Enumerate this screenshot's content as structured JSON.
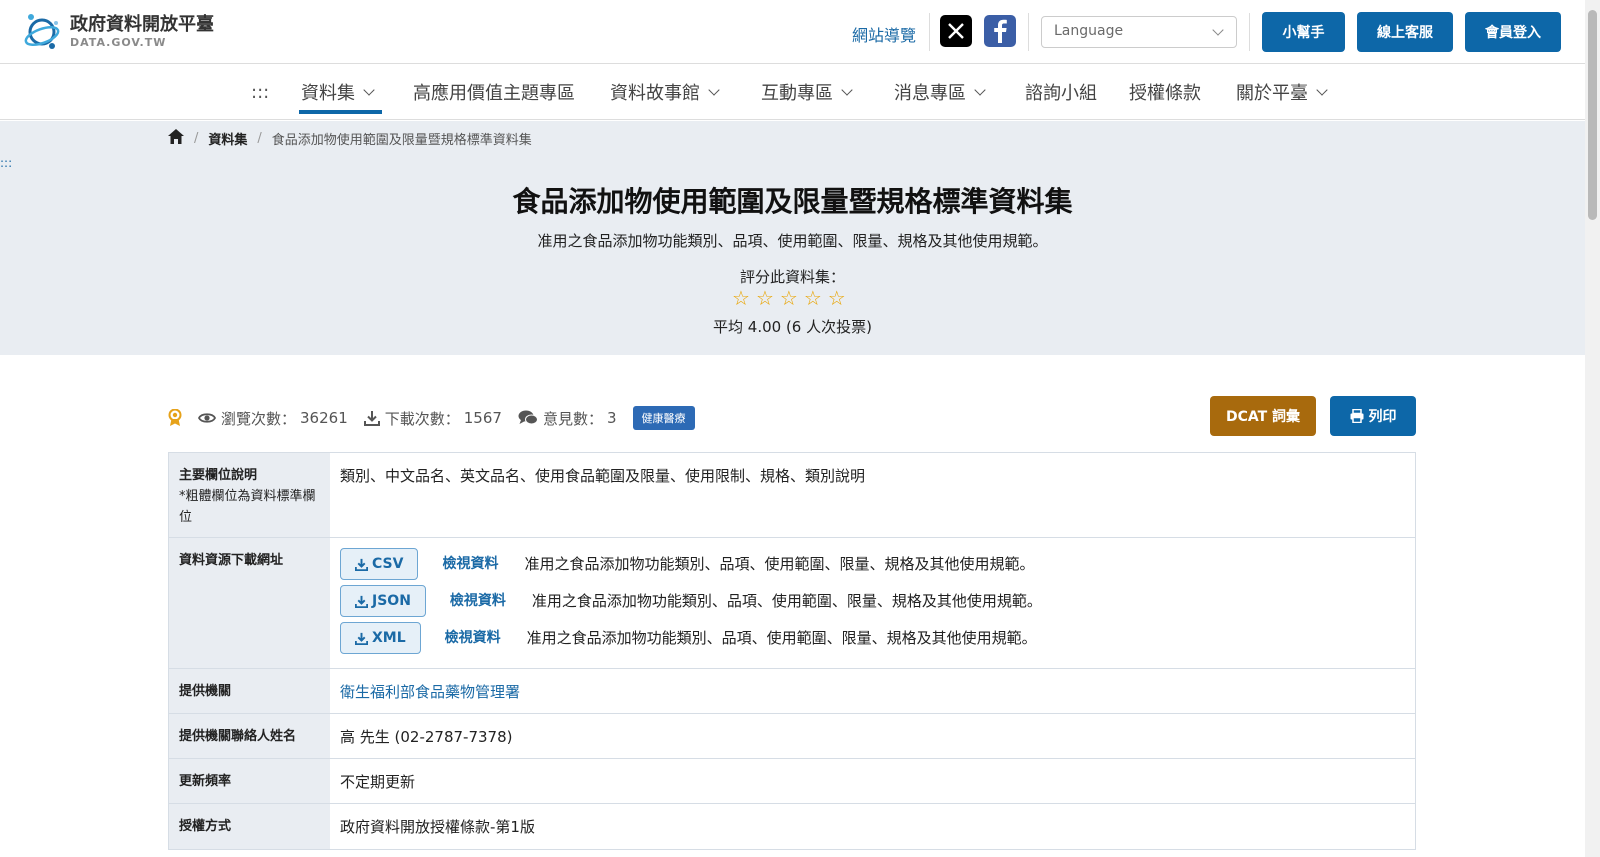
{
  "header": {
    "logo_zh": "政府資料開放平臺",
    "logo_en": "DATA.GOV.TW",
    "sitemap": "網站導覽",
    "x_icon": "x-logo-icon",
    "fb_icon": "facebook-icon",
    "language_placeholder": "Language",
    "buttons": {
      "helper": "小幫手",
      "support": "線上客服",
      "login": "會員登入"
    }
  },
  "nav": {
    "skip": ":::",
    "items": [
      {
        "label": "資料集",
        "has_menu": true,
        "active": true
      },
      {
        "label": "高應用價值主題專區",
        "has_menu": false
      },
      {
        "label": "資料故事館",
        "has_menu": true
      },
      {
        "label": "互動專區",
        "has_menu": true
      },
      {
        "label": "消息專區",
        "has_menu": true
      },
      {
        "label": "諮詢小組",
        "has_menu": false
      },
      {
        "label": "授權條款",
        "has_menu": false
      },
      {
        "label": "關於平臺",
        "has_menu": true
      }
    ]
  },
  "breadcrumb": {
    "home_icon": "home-icon",
    "section": "資料集",
    "current": "食品添加物使用範圍及限量暨規格標準資料集"
  },
  "skip_left": ":::",
  "dataset": {
    "title": "食品添加物使用範圍及限量暨規格標準資料集",
    "description": "准用之食品添加物功能類別、品項、使用範圍、限量、規格及其他使用規範。",
    "rate_label": "評分此資料集：",
    "stars_total": 5,
    "stars_filled": 0,
    "average_text": "平均 4.00 (6 人次投票)"
  },
  "stats": {
    "views_label": "瀏覽次數：",
    "views": "36261",
    "downloads_label": "下載次數：",
    "downloads": "1567",
    "comments_label": "意見數：",
    "comments": "3",
    "category": "健康醫療"
  },
  "actions": {
    "dcat": "DCAT 詞彙",
    "print": "列印"
  },
  "table": {
    "fields_label": "主要欄位說明",
    "fields_note": "*粗體欄位為資料標準欄位",
    "fields_value": "類別、中文品名、英文品名、使用食品範圍及限量、使用限制、規格、類別說明",
    "resources_label": "資料資源下載網址",
    "resources": [
      {
        "format": "CSV",
        "view": "檢視資料",
        "desc": "准用之食品添加物功能類別、品項、使用範圍、限量、規格及其他使用規範。"
      },
      {
        "format": "JSON",
        "view": "檢視資料",
        "desc": "准用之食品添加物功能類別、品項、使用範圍、限量、規格及其他使用規範。"
      },
      {
        "format": "XML",
        "view": "檢視資料",
        "desc": "准用之食品添加物功能類別、品項、使用範圍、限量、規格及其他使用規範。"
      }
    ],
    "provider_label": "提供機關",
    "provider_value": "衛生福利部食品藥物管理署",
    "contact_label": "提供機關聯絡人姓名",
    "contact_value": "高 先生 (02-2787-7378)",
    "frequency_label": "更新頻率",
    "frequency_value": "不定期更新",
    "license_label": "授權方式",
    "license_value": "政府資料開放授權條款-第1版"
  },
  "colors": {
    "primary": "#0d67a8",
    "dcat": "#a86a0d",
    "hero_bg": "#e9edf2",
    "star": "#e9a400",
    "badge": "#2d6ab5"
  }
}
